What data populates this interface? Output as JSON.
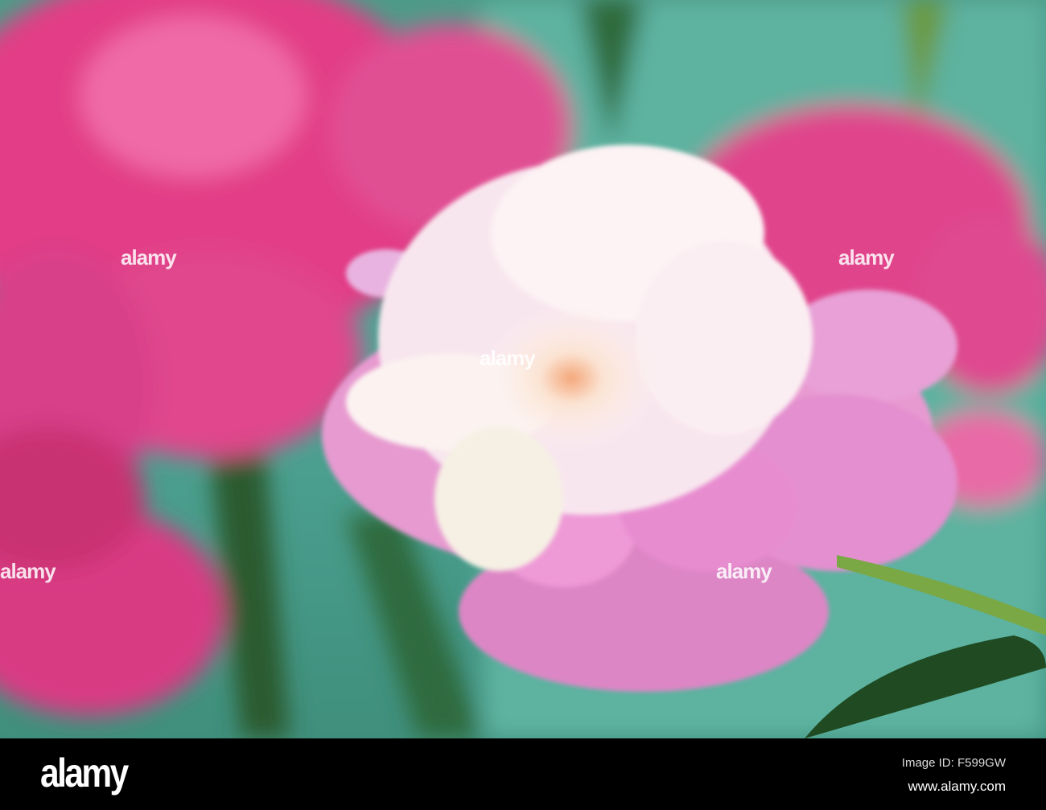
{
  "photo": {
    "subject": "Pink and white peony flower",
    "watermark": "alamy"
  },
  "footer": {
    "logo": "alamy",
    "image_id": "Image ID: F599GW",
    "website": "www.alamy.com"
  }
}
